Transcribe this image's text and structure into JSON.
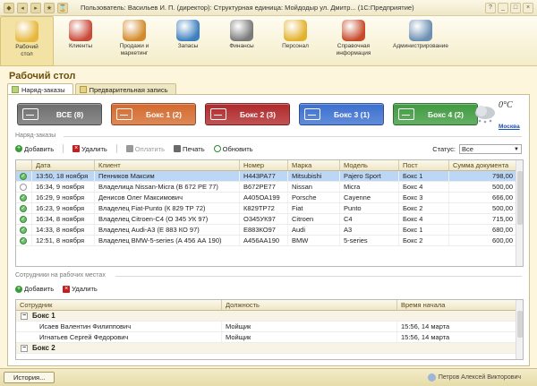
{
  "window": {
    "title": "Пользователь: Васильев И. П. (директор): Структурная единица: Мойдодыр ул. Дмитр... (1С:Предприятие)"
  },
  "sections": [
    {
      "label": "Рабочий\nстол",
      "icon": "desk-lamp-icon",
      "color": "#e6b73a",
      "active": true
    },
    {
      "label": "Клиенты",
      "icon": "clients-icon",
      "color": "#c94a3a",
      "active": false
    },
    {
      "label": "Продажи и\nмаркетинг",
      "icon": "sales-chart-icon",
      "color": "#d48a2b",
      "active": false
    },
    {
      "label": "Запасы",
      "icon": "stock-bottles-icon",
      "color": "#3d7fbf",
      "active": false
    },
    {
      "label": "Финансы",
      "icon": "cash-register-icon",
      "color": "#7a7a7a",
      "active": false
    },
    {
      "label": "Персонал",
      "icon": "staff-icon",
      "color": "#e3b12b",
      "active": false
    },
    {
      "label": "Справочная\nинформация",
      "icon": "reference-book-icon",
      "color": "#c64a2a",
      "active": false
    },
    {
      "label": "Администрирование",
      "icon": "administration-icon",
      "color": "#6c8fb3",
      "active": false
    }
  ],
  "page_title": "Рабочий стол",
  "tabs": [
    "Наряд-заказы",
    "Предварительная запись"
  ],
  "posts": [
    {
      "label": "ВСЕ (8)",
      "color": "#6e6e6e"
    },
    {
      "label": "Бокс 1 (2)",
      "color": "#d46a2e"
    },
    {
      "label": "Бокс 2 (3)",
      "color": "#b0282a"
    },
    {
      "label": "Бокс 3 (1)",
      "color": "#3b6fd0"
    },
    {
      "label": "Бокс 4 (2)",
      "color": "#3f9a3f"
    }
  ],
  "weather": {
    "temp": "0°C",
    "city": "Москва"
  },
  "orders_group": "Наряд-заказы",
  "orders_toolbar": {
    "add": "Добавить",
    "delete": "Удалить",
    "pay": "Оплатить",
    "print": "Печать",
    "refresh": "Обновить",
    "status_label": "Статус:",
    "status_value": "Все"
  },
  "orders_columns": [
    "Дата",
    "Клиент",
    "Номер",
    "Марка",
    "Модель",
    "Пост",
    "Сумма документа"
  ],
  "orders": [
    {
      "done": true,
      "date": "13:50, 18 ноября",
      "client": "Пенников Максим",
      "number": "Н443РА77",
      "brand": "Mitsubishi",
      "model": "Pajero Sport",
      "post": "Бокс 1",
      "sum": "798,00",
      "selected": true
    },
    {
      "done": false,
      "date": "16:34, 9 ноября",
      "client": "Владелица Nissan-Micra (В 672 РЕ 77)",
      "number": "В672РЕ77",
      "brand": "Nissan",
      "model": "Micra",
      "post": "Бокс 4",
      "sum": "500,00",
      "selected": false
    },
    {
      "done": true,
      "date": "16:29, 9 ноября",
      "client": "Денисов Олег Максимович",
      "number": "А405ОА199",
      "brand": "Porsche",
      "model": "Cayenne",
      "post": "Бокс 3",
      "sum": "666,00",
      "selected": false
    },
    {
      "done": true,
      "date": "16:23, 9 ноября",
      "client": "Владелец Fiat-Punto (К 829 ТР 72)",
      "number": "К829ТР72",
      "brand": "Fiat",
      "model": "Punto",
      "post": "Бокс 2",
      "sum": "500,00",
      "selected": false
    },
    {
      "done": true,
      "date": "16:34, 8 ноября",
      "client": "Владелец Citroen-C4 (О 345 УК 97)",
      "number": "О345УК97",
      "brand": "Citroen",
      "model": "C4",
      "post": "Бокс 4",
      "sum": "715,00",
      "selected": false
    },
    {
      "done": true,
      "date": "14:33, 8 ноября",
      "client": "Владелец Audi-A3 (Е 883 КО 97)",
      "number": "Е883КО97",
      "brand": "Audi",
      "model": "A3",
      "post": "Бокс 1",
      "sum": "680,00",
      "selected": false
    },
    {
      "done": true,
      "date": "12:51, 8 ноября",
      "client": "Владелец BMW-5-series (А 456 АА 190)",
      "number": "А456АА190",
      "brand": "BMW",
      "model": "5-series",
      "post": "Бокс 2",
      "sum": "600,00",
      "selected": false
    }
  ],
  "staff_group": "Сотрудники на рабочих местах",
  "staff_toolbar": {
    "add": "Добавить",
    "delete": "Удалить"
  },
  "staff_columns": [
    "Сотрудник",
    "Должность",
    "Время начала"
  ],
  "staff_groups": [
    {
      "name": "Бокс 1",
      "rows": [
        {
          "name": "Исаев Валентин Филиппович",
          "position": "Мойщик",
          "start": "15:56, 14 марта"
        },
        {
          "name": "Игнатьев Сергей Федорович",
          "position": "Мойщик",
          "start": "15:56, 14 марта"
        }
      ]
    },
    {
      "name": "Бокс 2",
      "rows": []
    }
  ],
  "bottom": {
    "history": "История...",
    "user": "Петров Алексей Викторович"
  }
}
